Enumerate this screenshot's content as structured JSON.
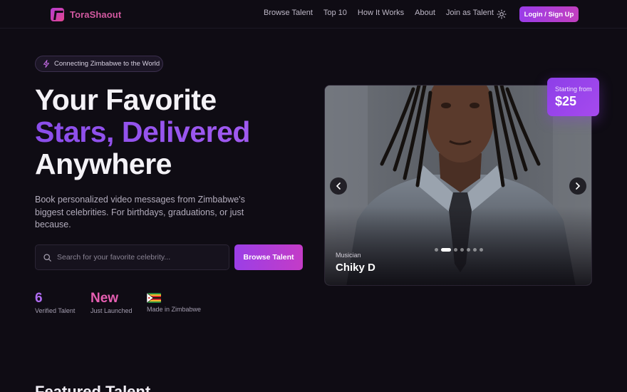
{
  "header": {
    "brand": "ToraShaout",
    "nav": [
      "Browse Talent",
      "Top 10",
      "How It Works",
      "About",
      "Join as Talent"
    ],
    "login_label": "Login / Sign Up"
  },
  "hero": {
    "badge": "Connecting Zimbabwe to the World",
    "headline_line1": "Your Favorite",
    "headline_line2": "Stars, Delivered",
    "headline_line3": "Anywhere",
    "subtext": "Book personalized video messages from Zimbabwe's biggest celebrities. For birthdays, graduations, or just because.",
    "search_placeholder": "Search for your favorite celebrity...",
    "browse_label": "Browse Talent",
    "stats": [
      {
        "value": "6",
        "label": "Verified Talent"
      },
      {
        "value": "New",
        "label": "Just Launched"
      },
      {
        "value": "",
        "label": "Made in Zimbabwe",
        "icon": "zimbabwe-flag"
      }
    ]
  },
  "card": {
    "price_label": "Starting from",
    "price_value": "$25",
    "category": "Musician",
    "name": "Chiky D",
    "slide_count": 7,
    "active_slide": 1
  },
  "section": {
    "featured_title": "Featured Talent"
  },
  "colors": {
    "background": "#0f0c14",
    "accent_purple": "#9b3ee6",
    "accent_pink": "#d259a0"
  }
}
